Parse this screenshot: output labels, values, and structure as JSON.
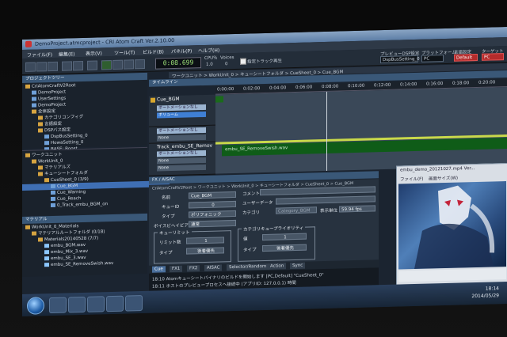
{
  "window": {
    "title": "DemoProject.atmcproject - CRI Atom Craft Ver.2.10.00"
  },
  "menu": [
    "ファイル(F)",
    "編集(E)",
    "表示(V)",
    "ツール(T)",
    "ビルド(B)",
    "パネル(P)",
    "ヘルプ(H)"
  ],
  "toolbar": {
    "time": "0:08.699",
    "cpu_label": "CPU%",
    "cpu_value": "1.0",
    "voices_label": "Voices",
    "voices_value": "0",
    "checkbox_label": "指定トラック再生",
    "preview_label": "プレビューDSP設定",
    "preview_value": "DspBusSetting_0",
    "platform_label": "プラットフォーム",
    "platform_value": "PC",
    "lang_label": "言語設定",
    "lang_value": "Default",
    "target_label": "ターゲット",
    "target_value": "PC"
  },
  "project_tree": {
    "title": "プロジェクトツリー",
    "items": [
      {
        "label": "CriAtomCraftV2Root",
        "indent": 0,
        "icon": "folder"
      },
      {
        "label": "DemoProject",
        "indent": 1,
        "icon": "file"
      },
      {
        "label": "UserSettings",
        "indent": 1,
        "icon": "file"
      },
      {
        "label": "DemoProject",
        "indent": 1,
        "icon": "file"
      },
      {
        "label": "全体設定",
        "indent": 1,
        "icon": "folder"
      },
      {
        "label": "カテゴリコンフィグ",
        "indent": 2,
        "icon": "folder"
      },
      {
        "label": "言語設定",
        "indent": 2,
        "icon": "folder"
      },
      {
        "label": "DSPバス設定",
        "indent": 2,
        "icon": "folder"
      },
      {
        "label": "DspBusSetting_0",
        "indent": 3,
        "icon": "file"
      },
      {
        "label": "HowaSetting_0",
        "indent": 3,
        "icon": "file"
      },
      {
        "label": "BASE: Boost",
        "indent": 3,
        "icon": "file"
      }
    ]
  },
  "work_tree": {
    "items": [
      {
        "label": "ワークユニット",
        "indent": 0,
        "icon": "folder",
        "hl": false
      },
      {
        "label": "WorkUnit_0",
        "indent": 1,
        "icon": "folder",
        "hl": false
      },
      {
        "label": "マテリアルズ",
        "indent": 2,
        "icon": "folder",
        "hl": false
      },
      {
        "label": "キューシートフォルダ",
        "indent": 2,
        "icon": "folder",
        "hl": false
      },
      {
        "label": "CueSheet_0 (3/9)",
        "indent": 3,
        "icon": "folder",
        "hl": false
      },
      {
        "label": "Cue_BGM",
        "indent": 4,
        "icon": "file",
        "hl": true
      },
      {
        "label": "Cue_Warning",
        "indent": 4,
        "icon": "file",
        "hl": false
      },
      {
        "label": "Cue_Reach",
        "indent": 4,
        "icon": "file",
        "hl": false
      },
      {
        "label": "0_Track_embu_BGM_on",
        "indent": 4,
        "icon": "file",
        "hl": false
      }
    ]
  },
  "material_tree": {
    "title": "マテリアル",
    "items": [
      {
        "label": "WorkUnit_0_Materials",
        "indent": 0,
        "icon": "folder"
      },
      {
        "label": "マテリアルルートフォルダ (0/18)",
        "indent": 1,
        "icon": "folder"
      },
      {
        "label": "Materials20140528 (7/7)",
        "indent": 2,
        "icon": "folder"
      },
      {
        "label": "embu_BGM.wav",
        "indent": 3,
        "icon": "wave"
      },
      {
        "label": "embu_Mix_3.wav",
        "indent": 3,
        "icon": "wave"
      },
      {
        "label": "embu_SE_3.wav",
        "indent": 3,
        "icon": "wave"
      },
      {
        "label": "embu_SE_RemoveSwish.wav",
        "indent": 3,
        "icon": "wave"
      }
    ]
  },
  "timeline": {
    "breadcrumb": "ワークユニット > WorkUnit_0 > キューシートフォルダ > CueSheet_0 > Cue_BGM",
    "title": "タイムライン",
    "ticks": [
      "0:00:00",
      "0:02:00",
      "0:04:00",
      "0:06:00",
      "0:08:00",
      "0:10:00",
      "0:12:00",
      "0:14:00",
      "0:16:00",
      "0:18:00",
      "0:20:00"
    ],
    "cue_name": "Cue_BGM",
    "track1_badge": "オートメーションなし",
    "track1_badge2": "ボリューム",
    "track2_badge": "オートメーションなし",
    "track2_badge2": "None",
    "track3_name": "Track_embu_SE_Remov",
    "track3_badge": "オートメーションなし",
    "track3_badge2": "None",
    "track3_badge3": "None",
    "waveform_label": "embu_SE_RemoveSwish.wav"
  },
  "properties": {
    "header": "FX / AISAC",
    "breadcrumb": "CriAtomCraftV2Root > ワークユニット > WorkUnit_0 > キューシートフォルダ > CueSheet_0 > Cue_BGM",
    "name_label": "名前",
    "name_value": "Cue_BGM",
    "cue_id_label": "キューID",
    "cue_id_value": "0",
    "type_label": "タイプ",
    "type_value": "ポリフォニック",
    "priority_label": "ボイスビヘイビア",
    "priority_value": "通常",
    "comment_label": "コメント",
    "user_label": "ユーザーデータ",
    "category_label": "カテゴリ",
    "category_value": "Category_BGM",
    "display_label": "表示単位",
    "display_value": "59.94 fps",
    "limit_group_label": "キューリミット",
    "limit_label": "リミット数",
    "limit_value": "1",
    "limit_type_label": "タイプ",
    "limit_type_value": "後着優先",
    "cat_limit_group_label": "カテゴリキュープライオリティ",
    "cat_value_label": "値",
    "cat_value": "1",
    "cat_type_label": "タイプ",
    "cat_type_value": "後着優先",
    "tabs": [
      "Cue",
      "FX1",
      "FX2",
      "AISAC",
      "Selector/Random",
      "Action",
      "Sync"
    ]
  },
  "log": {
    "lines": [
      "18:10  Atomキューシートバイナリのビルドを開始します  [PC,Default]  \"CueSheet_0\"",
      "18:11  ホストのプレビュープロセスへ接続中 (アプリID: 127.0.0.1)  時間"
    ]
  },
  "video": {
    "title": "embu_demo_20121027.mp4 Ver...",
    "menu": [
      "ファイル(F)",
      "画面サイズ(W)"
    ]
  },
  "taskbar": {
    "time": "18:14",
    "date": "2014/05/29"
  }
}
